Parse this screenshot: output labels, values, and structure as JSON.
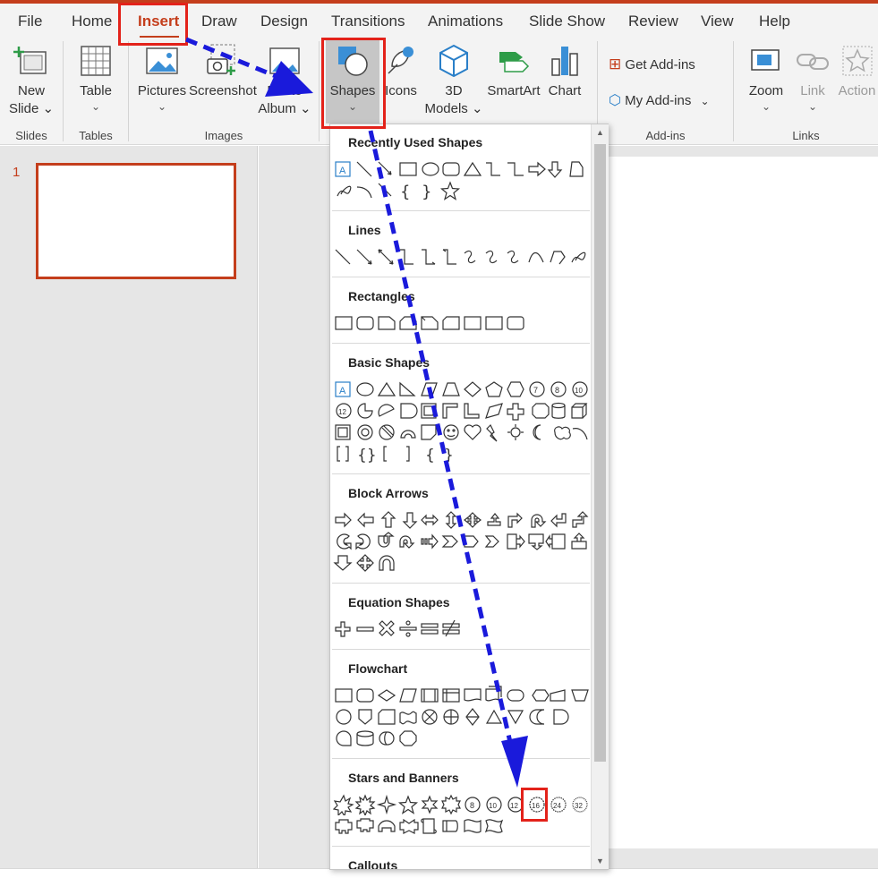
{
  "tabs": [
    {
      "label": "File"
    },
    {
      "label": "Home"
    },
    {
      "label": "Insert",
      "active": true
    },
    {
      "label": "Draw"
    },
    {
      "label": "Design"
    },
    {
      "label": "Transitions"
    },
    {
      "label": "Animations"
    },
    {
      "label": "Slide Show"
    },
    {
      "label": "Review"
    },
    {
      "label": "View"
    },
    {
      "label": "Help"
    }
  ],
  "ribbon": {
    "new_slide": {
      "line1": "New",
      "line2": "Slide ⌄"
    },
    "table": {
      "label": "Table",
      "caret": "⌄"
    },
    "pictures": {
      "label": "Pictures",
      "caret": "⌄"
    },
    "screenshot": {
      "label": "Screenshot",
      "caret": "⌄"
    },
    "photo_album": {
      "line1": "Photo",
      "line2": "Album ⌄"
    },
    "shapes": {
      "label": "Shapes",
      "caret": "⌄"
    },
    "icons": {
      "label": "Icons"
    },
    "models3d": {
      "line1": "3D",
      "line2": "Models ⌄"
    },
    "smartart": {
      "label": "SmartArt"
    },
    "chart": {
      "label": "Chart"
    },
    "get_addins": "Get Add-ins",
    "my_addins": "My Add-ins",
    "zoom": {
      "label": "Zoom",
      "caret": "⌄"
    },
    "link": {
      "label": "Link",
      "caret": "⌄"
    },
    "action": {
      "label": "Action"
    },
    "groups": {
      "slides": "Slides",
      "tables": "Tables",
      "images": "Images",
      "addins": "Add-ins",
      "links": "Links"
    }
  },
  "slide_pane": {
    "slide_number": "1"
  },
  "shapes_menu": {
    "sections": [
      {
        "title": "Recently Used Shapes"
      },
      {
        "title": "Lines"
      },
      {
        "title": "Rectangles"
      },
      {
        "title": "Basic Shapes"
      },
      {
        "title": "Block Arrows"
      },
      {
        "title": "Equation Shapes"
      },
      {
        "title": "Flowchart"
      },
      {
        "title": "Stars and Banners"
      },
      {
        "title": "Callouts"
      }
    ],
    "highlighted_shape": "Star: 16 Points"
  },
  "colors": {
    "accent": "#c43e1c",
    "annotation_red": "#e3221a",
    "annotation_arrow": "#1a1adb"
  }
}
